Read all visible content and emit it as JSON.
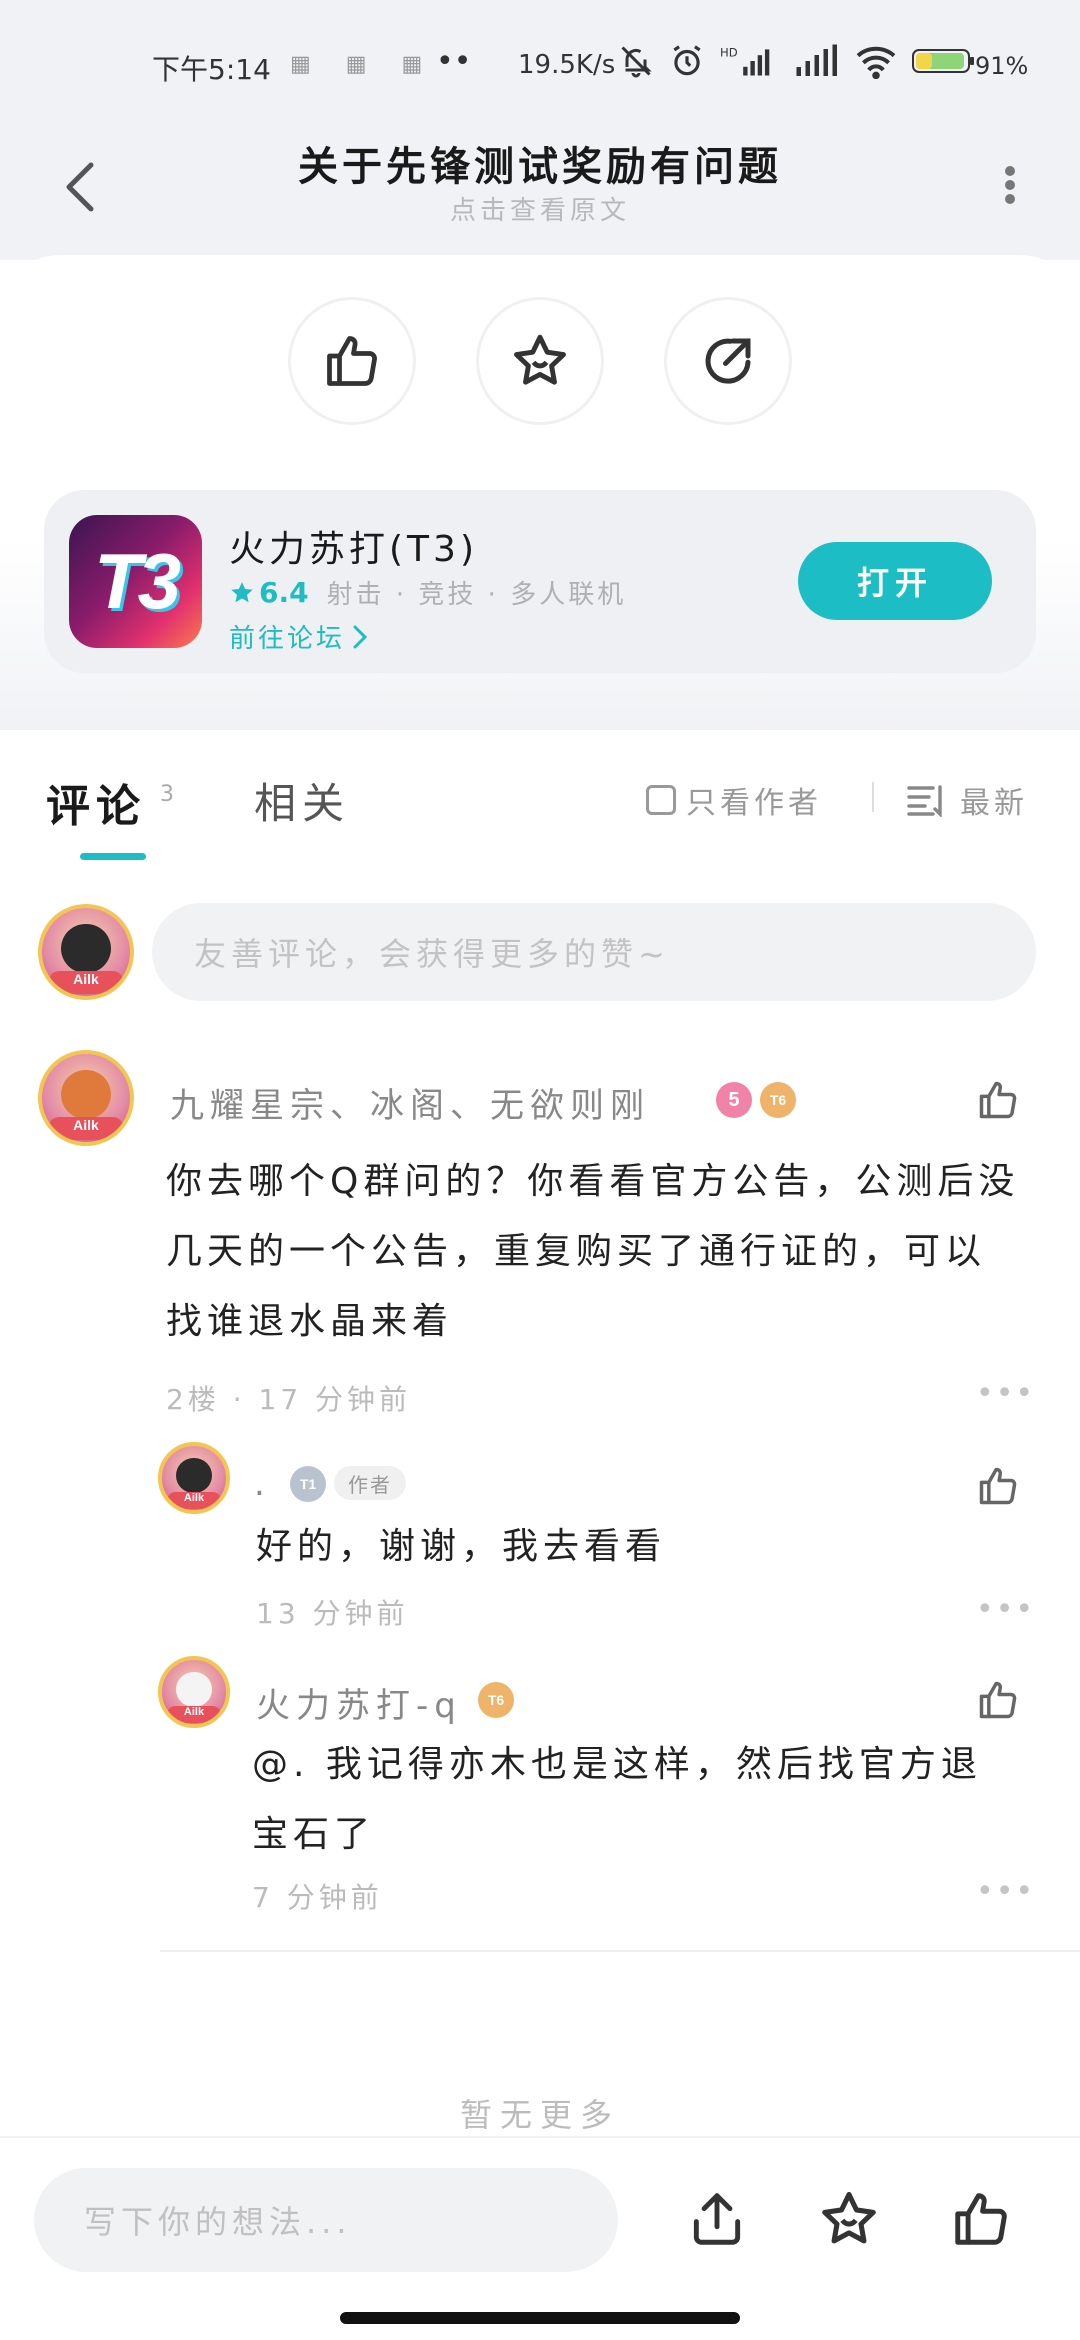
{
  "status_bar": {
    "time": "下午5:14",
    "notif_icons": "▦ ▦ ▦",
    "dots": "••",
    "net_speed": "19.5K/s",
    "battery": "91%"
  },
  "header": {
    "title": "关于先锋测试奖励有问题",
    "subtitle": "点击查看原文"
  },
  "game": {
    "icon_text": "T3",
    "name": "火力苏打(T3)",
    "rating": "6.4",
    "tags": "射击 · 竞技 · 多人联机",
    "forum_link": "前往论坛",
    "open_label": "打开"
  },
  "tabs": {
    "comments": "评论",
    "comments_count": "3",
    "related": "相关",
    "only_author": "只看作者",
    "sort": "最新"
  },
  "comment_input": {
    "placeholder": "友善评论，会获得更多的赞~"
  },
  "comments": [
    {
      "username": "九耀星宗、冰阁、无欲则刚",
      "badges": [
        "5",
        "T6"
      ],
      "text_lines": [
        "你去哪个Q群问的？你看看官方公告，公测后没",
        "几天的一个公告，重复购买了通行证的，可以",
        "找谁退水晶来着"
      ],
      "meta": "2楼 · 17 分钟前"
    }
  ],
  "replies": [
    {
      "username": ".",
      "badge": "T1",
      "author_tag": "作者",
      "text": "好的，谢谢，我去看看",
      "meta": "13 分钟前"
    },
    {
      "username": "火力苏打-q",
      "badge": "T6",
      "text_lines": [
        "@.  我记得亦木也是这样，然后找官方退",
        "宝石了"
      ],
      "meta": "7 分钟前"
    }
  ],
  "footer": {
    "no_more": "暂无更多",
    "write_placeholder": "写下你的想法..."
  },
  "colors": {
    "accent": "#1dbdc6",
    "background_gray": "#f1f2f5"
  }
}
